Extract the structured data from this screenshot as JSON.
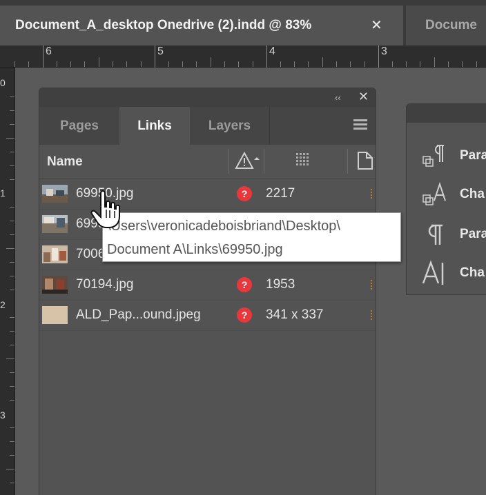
{
  "document_tabs": {
    "active_title": "Document_A_desktop Onedrive (2).indd @ 83%",
    "active_close": "✕",
    "inactive_title": "Docume"
  },
  "ruler_top": {
    "labels": [
      "6",
      "5",
      "4",
      "3"
    ]
  },
  "ruler_left": {
    "labels": [
      "0",
      "1",
      "2",
      "3"
    ]
  },
  "links_panel": {
    "collapse_icon": "double-chevron-left-icon",
    "collapse_glyph": "‹‹",
    "close_glyph": "✕",
    "tabs": [
      {
        "label": "Pages",
        "active": false
      },
      {
        "label": "Links",
        "active": true
      },
      {
        "label": "Layers",
        "active": false
      }
    ],
    "menu_icon": "panel-menu-icon",
    "header": {
      "name_label": "Name",
      "status_icon": "warning-icon",
      "page_icon": "page-icon"
    },
    "rows": [
      {
        "file": "69950.jpg",
        "status": "?",
        "info": "2217"
      },
      {
        "file": "6995",
        "status": "",
        "info": ""
      },
      {
        "file": "7006",
        "status": "",
        "info": ""
      },
      {
        "file": "70194.jpg",
        "status": "?",
        "info": "1953"
      },
      {
        "file": "ALD_Pap...ound.jpeg",
        "status": "?",
        "info": "341 x 337"
      }
    ],
    "status_color": "#e8383c"
  },
  "tooltip": {
    "line1": "\\Users\\veronicadeboisbriand\\Desktop\\",
    "line2": "Document A\\Links\\69950.jpg"
  },
  "styles_panel": {
    "items": [
      {
        "label": "Para",
        "icon": "paragraph-style-group-icon"
      },
      {
        "label": "Cha",
        "icon": "character-style-group-icon"
      },
      {
        "label": "Para",
        "icon": "paragraph-style-icon"
      },
      {
        "label": "Cha",
        "icon": "character-style-icon"
      }
    ]
  },
  "colors": {
    "background": "#5a5a5a",
    "panel": "#535353",
    "accent_link_mark": "#c47a2c"
  }
}
